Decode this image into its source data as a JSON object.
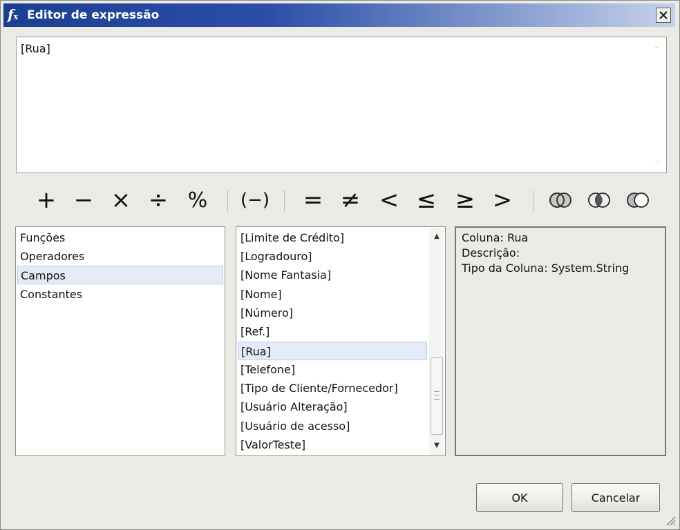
{
  "window": {
    "icon": "fx-function-icon",
    "icon_glyph": "f",
    "icon_sub": "x",
    "title": "Editor de expressão"
  },
  "expression": {
    "value": "[Rua]"
  },
  "operators": [
    {
      "name": "plus",
      "glyph": "+"
    },
    {
      "name": "minus",
      "glyph": "−"
    },
    {
      "name": "multiply",
      "glyph": "×"
    },
    {
      "name": "divide",
      "glyph": "÷"
    },
    {
      "name": "modulo",
      "glyph": "%"
    },
    {
      "name": "negate",
      "glyph": "(−)"
    },
    {
      "name": "equal",
      "glyph": "="
    },
    {
      "name": "not-equal",
      "glyph": "≠"
    },
    {
      "name": "less-than",
      "glyph": "<"
    },
    {
      "name": "less-equal",
      "glyph": "≤"
    },
    {
      "name": "greater-equal",
      "glyph": "≥"
    },
    {
      "name": "greater-than",
      "glyph": ">"
    },
    {
      "name": "or-icon",
      "glyph": ""
    },
    {
      "name": "and-icon",
      "glyph": ""
    },
    {
      "name": "not-icon",
      "glyph": ""
    }
  ],
  "categories": {
    "items": [
      "Funções",
      "Operadores",
      "Campos",
      "Constantes"
    ],
    "selected": "Campos"
  },
  "fields": {
    "items": [
      "[Limite de Crédito]",
      "[Logradouro]",
      "[Nome Fantasia]",
      "[Nome]",
      "[Número]",
      "[Ref.]",
      "[Rua]",
      "[Telefone]",
      "[Tipo de Cliente/Fornecedor]",
      "[Usuário Alteração]",
      "[Usuário de acesso]",
      "[ValorTeste]"
    ],
    "selected": "[Rua]"
  },
  "info": {
    "coluna": "Coluna: Rua",
    "descricao": "Descrição:",
    "tipo": "Tipo da Coluna: System.String"
  },
  "buttons": {
    "ok": "OK",
    "cancel": "Cancelar"
  },
  "colors": {
    "title_gradient_start": "#1a3f91",
    "selection_bg": "#e4ebf7"
  }
}
